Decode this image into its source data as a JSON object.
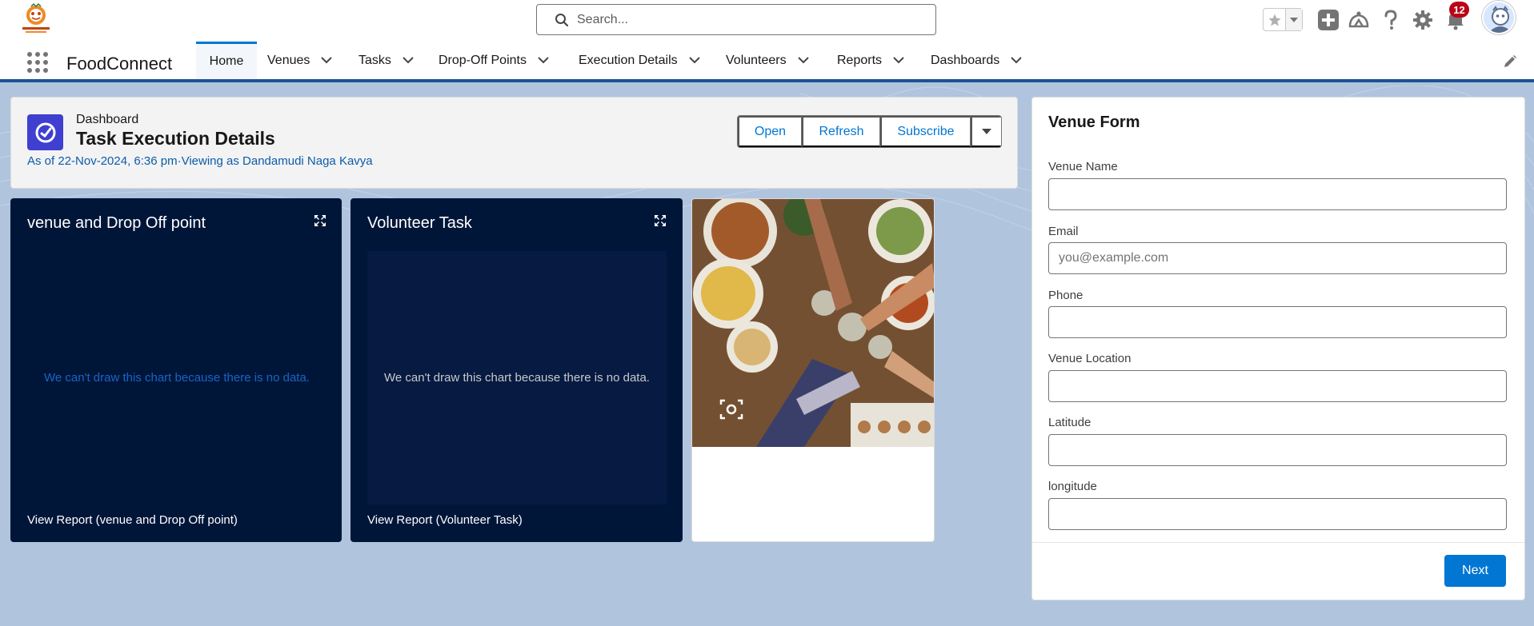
{
  "app": {
    "name": "FoodConnect",
    "logo_text": "FOOD CONNECT"
  },
  "search": {
    "placeholder": "Search..."
  },
  "notifications": {
    "count": "12"
  },
  "nav": {
    "items": [
      {
        "label": "Home",
        "active": true
      },
      {
        "label": "Venues"
      },
      {
        "label": "Tasks"
      },
      {
        "label": "Drop-Off Points"
      },
      {
        "label": "Execution Details"
      },
      {
        "label": "Volunteers"
      },
      {
        "label": "Reports"
      },
      {
        "label": "Dashboards"
      }
    ]
  },
  "dashboard": {
    "eyebrow": "Dashboard",
    "title": "Task Execution Details",
    "subtitle": "As of 22-Nov-2024, 6:36 pm·Viewing as Dandamudi Naga Kavya",
    "buttons": {
      "open": "Open",
      "refresh": "Refresh",
      "subscribe": "Subscribe"
    }
  },
  "tiles": [
    {
      "title": "venue and Drop Off point",
      "empty_message": "We can't draw this chart because there is no data.",
      "link": "View Report (venue and Drop Off point)"
    },
    {
      "title": "Volunteer Task",
      "empty_message": "We can't draw this chart because there is no data.",
      "link": "View Report (Volunteer Task)"
    }
  ],
  "venue_form": {
    "title": "Venue Form",
    "fields": [
      {
        "label": "Venue Name",
        "value": "",
        "placeholder": ""
      },
      {
        "label": "Email",
        "value": "",
        "placeholder": "you@example.com"
      },
      {
        "label": "Phone",
        "value": "",
        "placeholder": ""
      },
      {
        "label": "Venue Location",
        "value": "",
        "placeholder": ""
      },
      {
        "label": "Latitude",
        "value": "",
        "placeholder": ""
      },
      {
        "label": "longitude",
        "value": "",
        "placeholder": ""
      }
    ],
    "next_label": "Next"
  },
  "colors": {
    "brand": "#0176d3",
    "tile_bg": "#001639",
    "dash_icon": "#3f3fd0",
    "badge": "#ba0517",
    "page_bg": "#b0c4de"
  }
}
